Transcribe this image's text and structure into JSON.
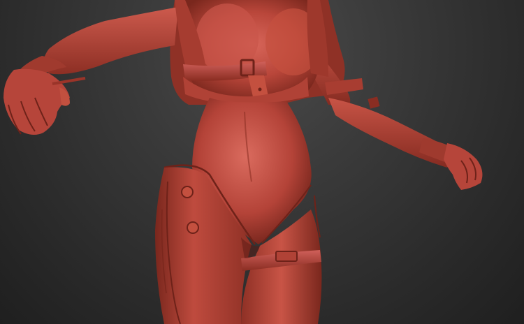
{
  "scene": {
    "colors": {
      "background_top": "#4a4a4a",
      "background_bottom": "#1f1f1f",
      "clay_base": "#b9463a",
      "clay_light": "#d8665a",
      "clay_shadow": "#6e2219",
      "crease": "#5a1a13"
    }
  }
}
